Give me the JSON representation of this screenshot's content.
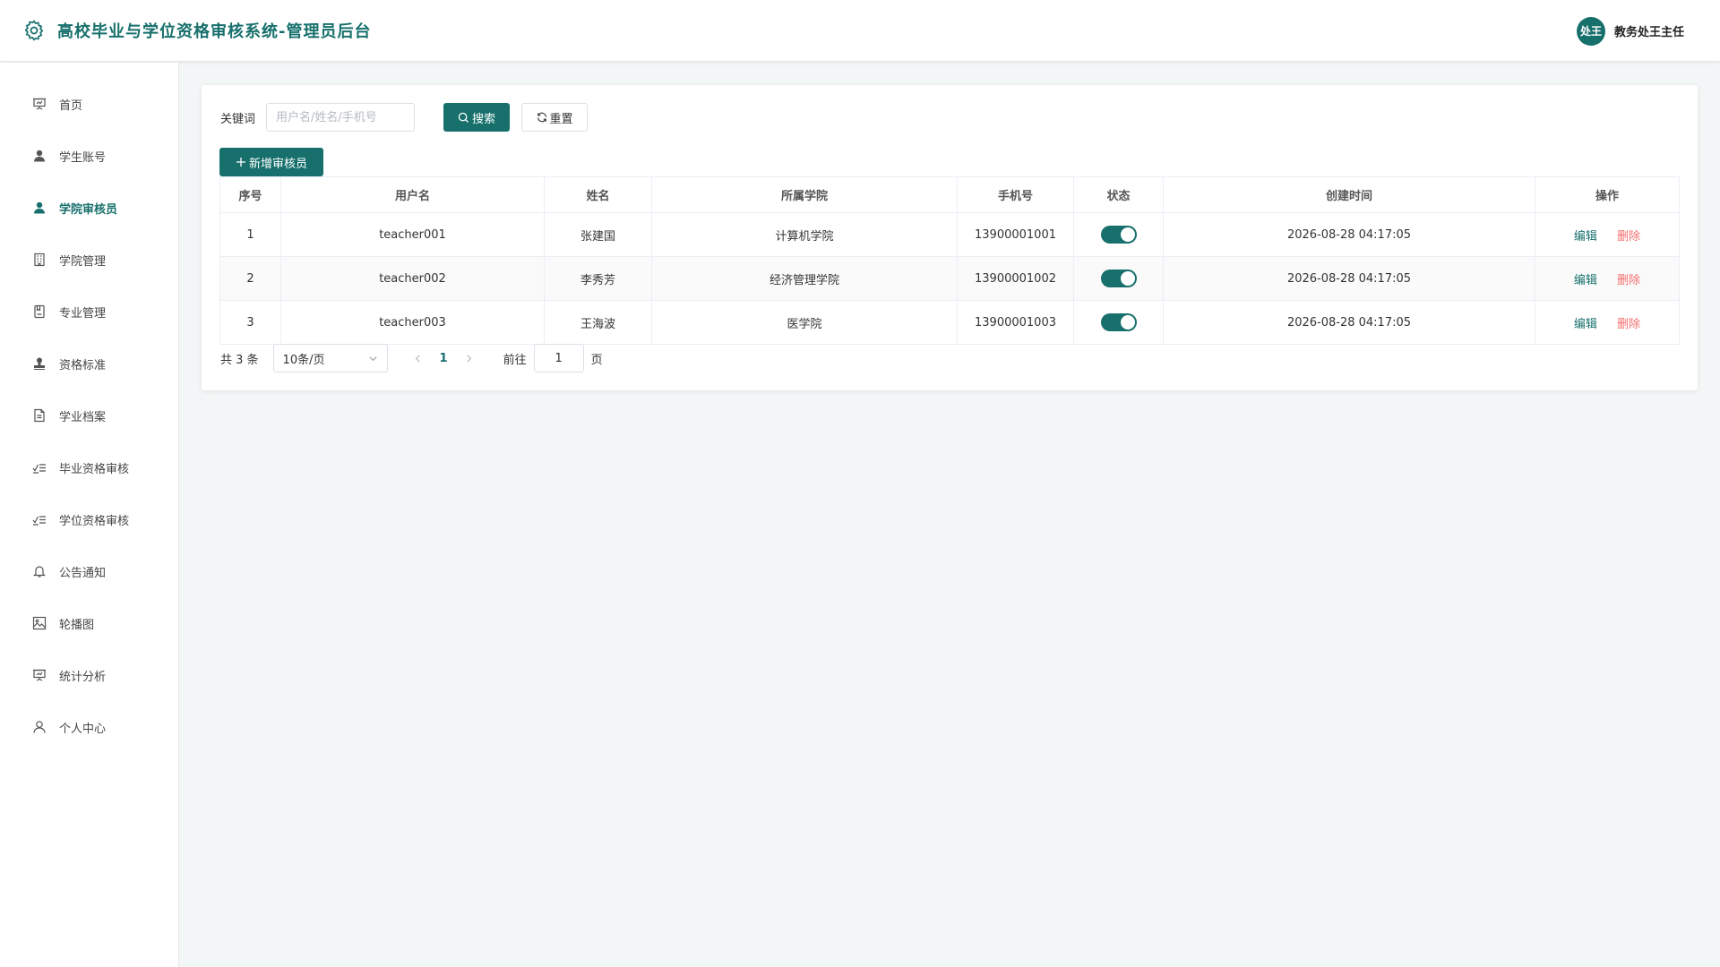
{
  "header": {
    "title": "高校毕业与学位资格审核系统-管理员后台",
    "avatar_text": "处王",
    "user_name": "教务处王主任"
  },
  "sidebar": {
    "items": [
      {
        "label": "首页",
        "icon": "presentation-icon"
      },
      {
        "label": "学生账号",
        "icon": "user-filled-icon"
      },
      {
        "label": "学院审核员",
        "icon": "user-filled-icon",
        "active": true
      },
      {
        "label": "学院管理",
        "icon": "building-icon"
      },
      {
        "label": "专业管理",
        "icon": "notebook-icon"
      },
      {
        "label": "资格标准",
        "icon": "stamp-icon"
      },
      {
        "label": "学业档案",
        "icon": "document-icon"
      },
      {
        "label": "毕业资格审核",
        "icon": "checklist-icon"
      },
      {
        "label": "学位资格审核",
        "icon": "checklist-icon"
      },
      {
        "label": "公告通知",
        "icon": "bell-icon"
      },
      {
        "label": "轮播图",
        "icon": "picture-icon"
      },
      {
        "label": "统计分析",
        "icon": "presentation-icon"
      },
      {
        "label": "个人中心",
        "icon": "user-outline-icon"
      }
    ]
  },
  "search": {
    "label": "关键词",
    "placeholder": "用户名/姓名/手机号",
    "value": "",
    "search_button": "搜索",
    "reset_button": "重置"
  },
  "toolbar": {
    "add_button": "新增审核员"
  },
  "table": {
    "columns": [
      "序号",
      "用户名",
      "姓名",
      "所属学院",
      "手机号",
      "状态",
      "创建时间",
      "操作"
    ],
    "rows": [
      {
        "index": "1",
        "username": "teacher001",
        "name": "张建国",
        "college": "计算机学院",
        "phone": "13900001001",
        "status": true,
        "created": "2026-08-28 04:17:05"
      },
      {
        "index": "2",
        "username": "teacher002",
        "name": "李秀芳",
        "college": "经济管理学院",
        "phone": "13900001002",
        "status": true,
        "created": "2026-08-28 04:17:05"
      },
      {
        "index": "3",
        "username": "teacher003",
        "name": "王海波",
        "college": "医学院",
        "phone": "13900001003",
        "status": true,
        "created": "2026-08-28 04:17:05"
      }
    ],
    "edit_label": "编辑",
    "delete_label": "删除"
  },
  "pagination": {
    "total_text": "共 3 条",
    "page_size": "10条/页",
    "current_page": "1",
    "goto_label": "前往",
    "goto_value": "1",
    "page_suffix": "页"
  },
  "colors": {
    "accent": "#17706c",
    "danger": "#f56c6c"
  }
}
